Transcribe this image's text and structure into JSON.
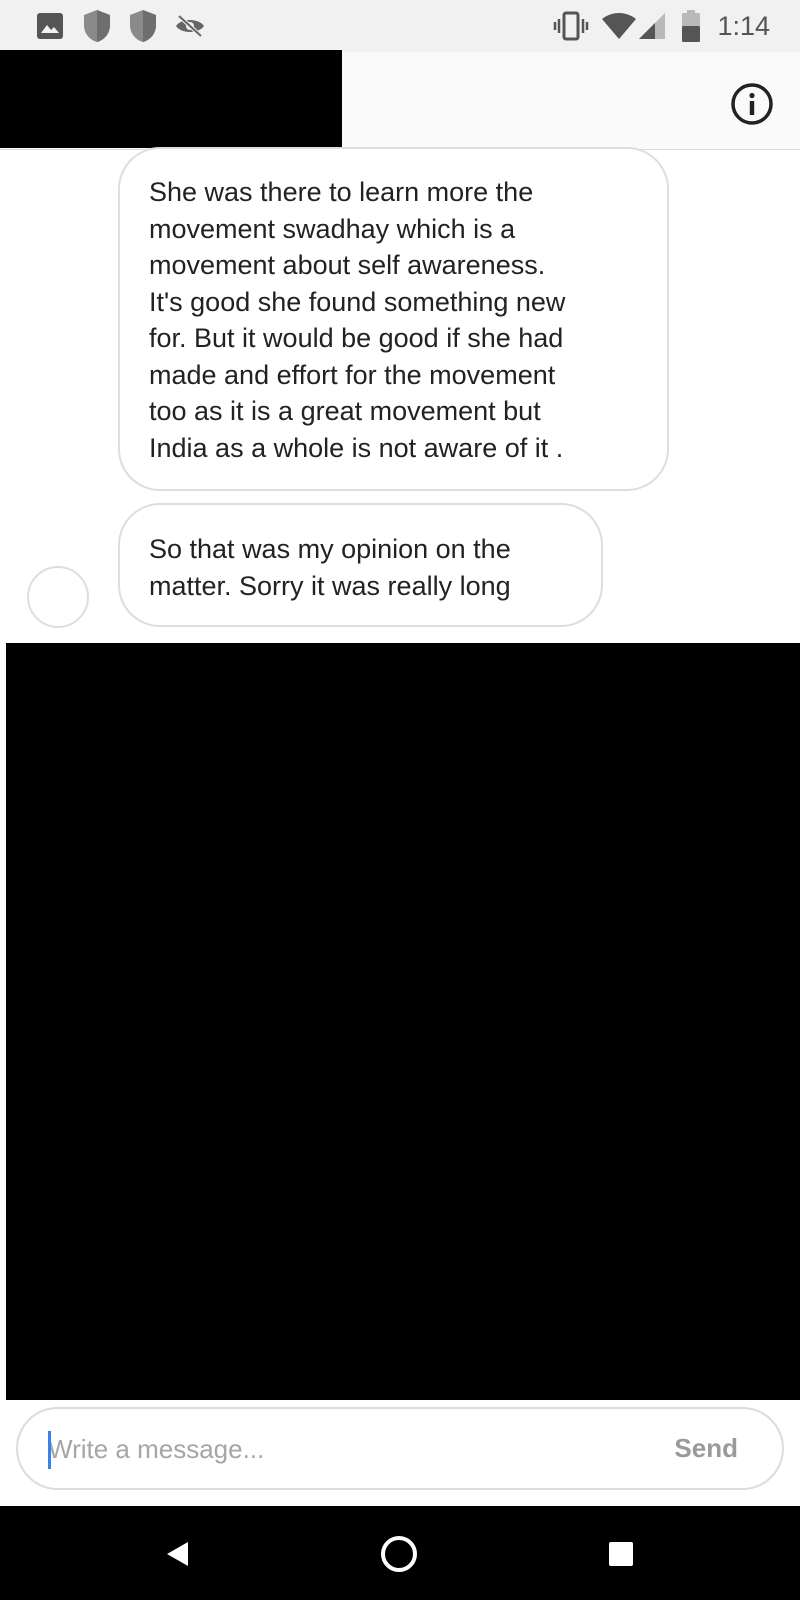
{
  "status_bar": {
    "time": "1:14",
    "left_icons": [
      "image-icon",
      "shield-icon",
      "shield-icon",
      "eye-off-icon"
    ],
    "right_icons": [
      "vibrate-icon",
      "wifi-icon",
      "signal-icon",
      "battery-icon"
    ]
  },
  "header": {
    "title": "",
    "info_icon": "info-icon"
  },
  "messages": [
    {
      "text": "She was there to learn more the\nmovement swadhay which is a\nmovement about self awareness.\nIt's good she found something new\nfor. But it would be good if she had\nmade and effort for the movement\ntoo as it is a great movement but\nIndia as a whole is not aware of it ."
    },
    {
      "text": "So that was my opinion on the\nmatter. Sorry it was really long"
    }
  ],
  "composer": {
    "placeholder": "Write a message...",
    "value": "",
    "send_label": "Send"
  },
  "colors": {
    "status_bar_bg": "#f1f1f1",
    "header_bg": "#fafafa",
    "bubble_border": "#dedede",
    "caret": "#3b82e8",
    "send_text": "#9a9a9a"
  },
  "nav_bar": {
    "buttons": [
      "back-icon",
      "home-icon",
      "recents-icon"
    ]
  }
}
